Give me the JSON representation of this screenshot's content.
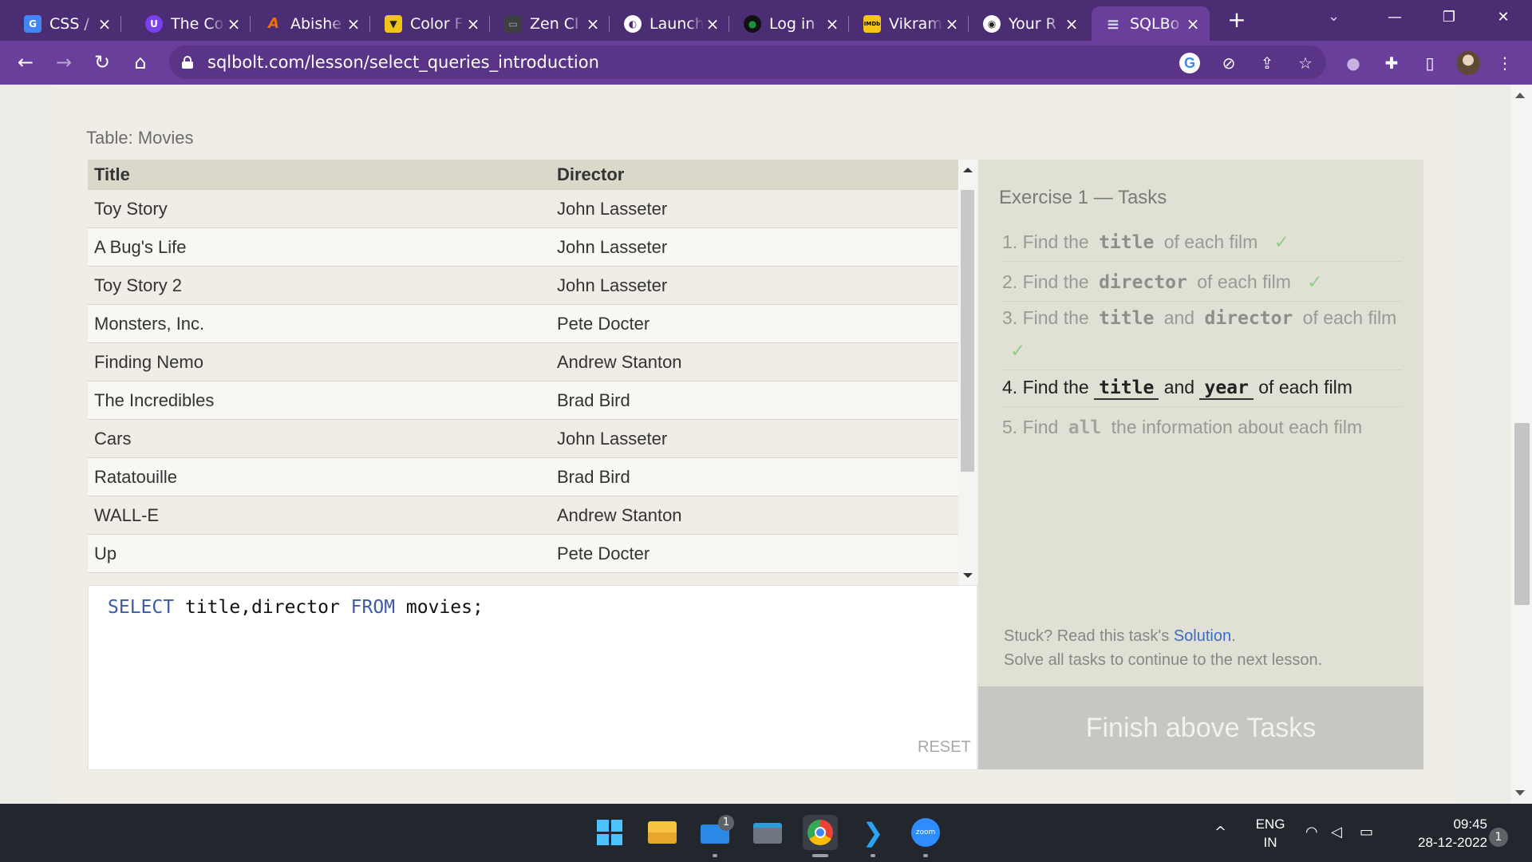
{
  "browser": {
    "tabs": [
      {
        "label": "CSS / C",
        "color": "#4285f4",
        "glyph": "G"
      },
      {
        "label": "The Co",
        "color": "#7b3ff2",
        "glyph": "U"
      },
      {
        "label": "Abishe",
        "color": "#e8710a",
        "glyph": "A"
      },
      {
        "label": "Color F",
        "color": "#f0c419",
        "glyph": "▼"
      },
      {
        "label": "Zen Cl",
        "color": "#3c4043",
        "glyph": "▭"
      },
      {
        "label": "Launch",
        "color": "#ffffff",
        "glyph": "◐"
      },
      {
        "label": "Log in",
        "color": "#1e8e3e",
        "glyph": "●"
      },
      {
        "label": "Vikram",
        "color": "#f5c518",
        "glyph": "IMDb"
      },
      {
        "label": "Your R",
        "color": "#ffffff",
        "glyph": "◉"
      },
      {
        "label": "SQLBo",
        "color": "#cfd8dc",
        "glyph": "≡",
        "active": true
      }
    ],
    "url": "sqlbolt.com/lesson/select_queries_introduction"
  },
  "page": {
    "table_caption": "Table: Movies",
    "columns": [
      "Title",
      "Director"
    ],
    "rows": [
      [
        "Toy Story",
        "John Lasseter"
      ],
      [
        "A Bug's Life",
        "John Lasseter"
      ],
      [
        "Toy Story 2",
        "John Lasseter"
      ],
      [
        "Monsters, Inc.",
        "Pete Docter"
      ],
      [
        "Finding Nemo",
        "Andrew Stanton"
      ],
      [
        "The Incredibles",
        "Brad Bird"
      ],
      [
        "Cars",
        "John Lasseter"
      ],
      [
        "Ratatouille",
        "Brad Bird"
      ],
      [
        "WALL-E",
        "Andrew Stanton"
      ],
      [
        "Up",
        "Pete Docter"
      ]
    ],
    "query": {
      "kw1": "SELECT",
      "part1": " title,director ",
      "kw2": "FROM",
      "part2": " movies;"
    },
    "reset_label": "RESET"
  },
  "tasks": {
    "title": "Exercise 1 — Tasks",
    "items": [
      {
        "num": "1.",
        "pre": "Find the",
        "c1": "title",
        "post": "of each film",
        "done": true
      },
      {
        "num": "2.",
        "pre": "Find the",
        "c1": "director",
        "post": "of each film",
        "done": true
      },
      {
        "num": "3.",
        "pre": "Find the",
        "c1": "title",
        "mid": "and",
        "c2": "director",
        "post": "of each film",
        "done": true
      },
      {
        "num": "4.",
        "pre": "Find the",
        "c1": "title",
        "mid": "and",
        "c2": "year",
        "post": "of each film",
        "current": true
      },
      {
        "num": "5.",
        "pre": "Find",
        "c1": "all",
        "post": "the information about each film"
      }
    ],
    "check_mark": "✓",
    "stuck_text": "Stuck? Read this task's",
    "solution_link": "Solution",
    "stuck_end": ".",
    "continue_text": "Solve all tasks to continue to the next lesson.",
    "finish_label": "Finish above Tasks"
  },
  "taskbar": {
    "mail_badge": "1",
    "lang_line1": "ENG",
    "lang_line2": "IN",
    "time": "09:45",
    "date": "28-12-2022",
    "notification_count": "1",
    "zoom_label": "zoom"
  }
}
